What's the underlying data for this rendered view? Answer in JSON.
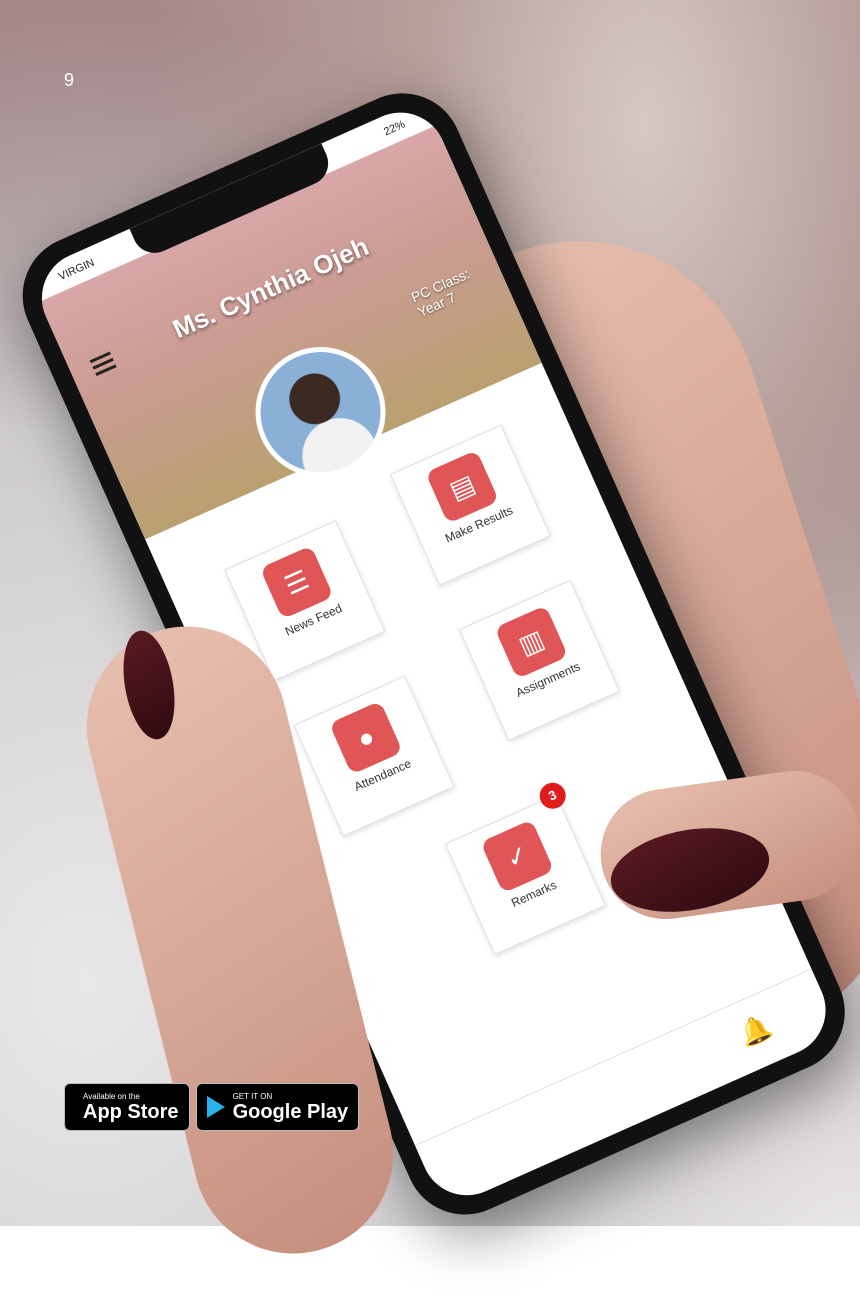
{
  "page": {
    "number": "9"
  },
  "phone": {
    "status": {
      "carrier": "VIRGIN",
      "battery": "22%"
    },
    "header": {
      "teacher_name": "Ms. Cynthia Ojeh",
      "pc_class_label": "PC Class:",
      "pc_class_value": "Year 7"
    },
    "tiles": [
      {
        "label": "News Feed",
        "icon": "news-feed-icon"
      },
      {
        "label": "Make Results",
        "icon": "folder-icon"
      },
      {
        "label": "Attendance",
        "icon": "attendance-user-icon"
      },
      {
        "label": "Assignments",
        "icon": "notebook-icon"
      },
      {
        "label": "Remarks",
        "icon": "checklist-icon",
        "badge": "3"
      }
    ],
    "bottom_bar": {
      "icon": "bell-icon"
    }
  },
  "badges": {
    "app_store": {
      "small": "Available on the",
      "big": "App Store",
      "icon": "apple-icon"
    },
    "google_play": {
      "small": "GET IT ON",
      "big": "Google Play",
      "icon": "play-icon"
    }
  },
  "colors": {
    "accent": "#e05555",
    "badge": "#e01b1b"
  }
}
